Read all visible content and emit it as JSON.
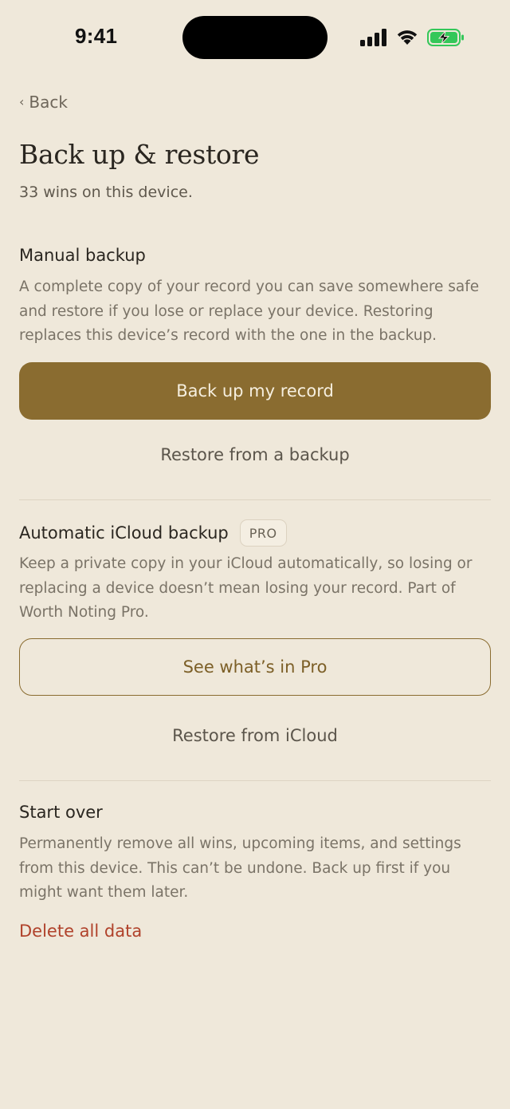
{
  "status_bar": {
    "time": "9:41",
    "icons": [
      "signal-icon",
      "wifi-icon",
      "battery-charging-icon"
    ],
    "battery_color": "#34C759"
  },
  "nav": {
    "back_label": "Back"
  },
  "header": {
    "title": "Back up & restore",
    "subtitle": "33 wins on this device."
  },
  "manual_backup": {
    "heading": "Manual backup",
    "description": "A complete copy of your record you can save somewhere safe and restore if you lose or replace your device. Restoring replaces this device’s record with the one in the backup.",
    "primary_button": "Back up my record",
    "secondary_button": "Restore from a backup"
  },
  "icloud_backup": {
    "heading": "Automatic iCloud backup",
    "badge": "PRO",
    "description": "Keep a private copy in your iCloud automatically, so losing or replacing a device doesn’t mean losing your record. Part of Worth Noting Pro.",
    "outline_button": "See what’s in Pro",
    "secondary_button": "Restore from iCloud"
  },
  "start_over": {
    "heading": "Start over",
    "description": "Permanently remove all wins, upcoming items, and settings from this device. This can’t be undone. Back up first if you might want them later.",
    "danger_button": "Delete all data"
  },
  "colors": {
    "background": "#EFE8DA",
    "accent": "#8A6C30",
    "danger": "#B0422B"
  }
}
